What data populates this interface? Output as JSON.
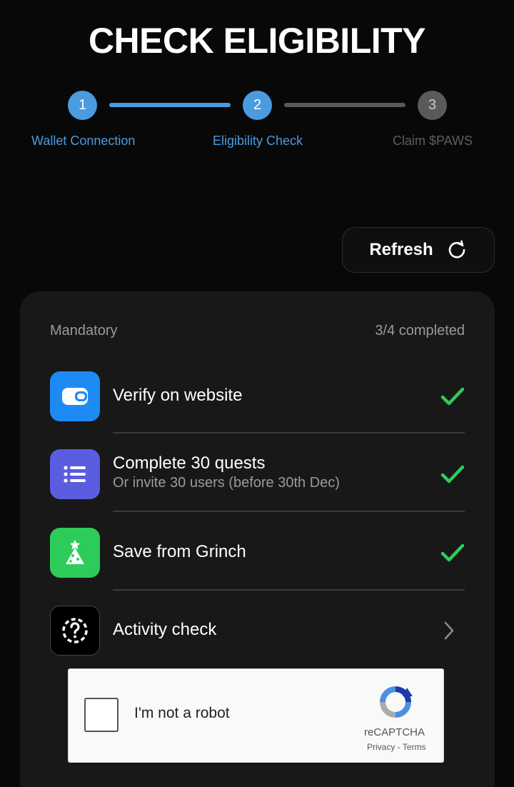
{
  "page": {
    "title": "CHECK ELIGIBILITY"
  },
  "stepper": {
    "steps": [
      {
        "number": "1",
        "label": "Wallet Connection",
        "state": "done"
      },
      {
        "number": "2",
        "label": "Eligibility Check",
        "state": "active"
      },
      {
        "number": "3",
        "label": "Claim $PAWS",
        "state": "pending"
      }
    ]
  },
  "refresh": {
    "label": "Refresh",
    "icon": "refresh-icon"
  },
  "card": {
    "section_label": "Mandatory",
    "progress": "3/4 completed",
    "tasks": [
      {
        "title": "Verify on website",
        "subtitle": "",
        "icon": "wallet-icon",
        "status": "completed"
      },
      {
        "title": "Complete 30 quests",
        "subtitle": "Or invite 30 users (before 30th Dec)",
        "icon": "list-icon",
        "status": "completed"
      },
      {
        "title": "Save from Grinch",
        "subtitle": "",
        "icon": "christmas-tree-icon",
        "status": "completed"
      },
      {
        "title": "Activity check",
        "subtitle": "",
        "icon": "question-icon",
        "status": "pending"
      }
    ]
  },
  "recaptcha": {
    "label": "I'm not a robot",
    "brand": "reCAPTCHA",
    "privacy": "Privacy",
    "separator": " - ",
    "terms": "Terms"
  },
  "colors": {
    "accent_blue": "#4a9be0",
    "inactive_gray": "#5a5a5a",
    "success_green": "#2ecc5b",
    "wallet_blue": "#1e8bf5",
    "list_purple": "#5b5ce0",
    "grinch_green": "#2dcc5a"
  }
}
